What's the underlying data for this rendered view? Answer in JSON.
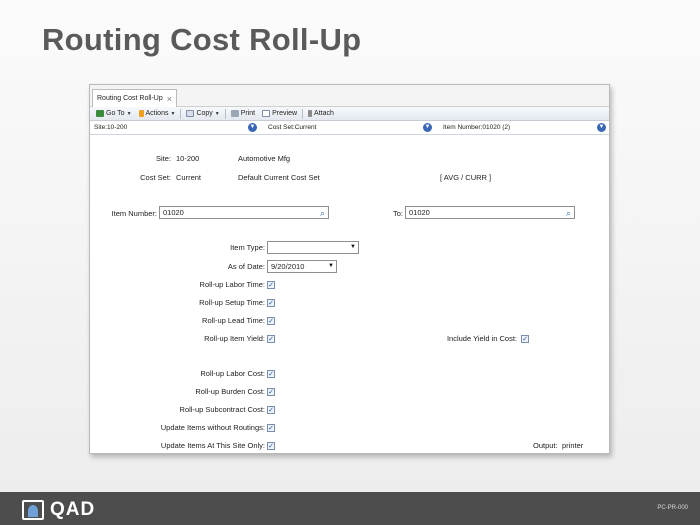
{
  "slide": {
    "title": "Routing Cost Roll-Up",
    "footer_code": "PC-PR-000",
    "brand": "QAD"
  },
  "tab": {
    "label": "Routing Cost Roll-Up",
    "close": "×"
  },
  "toolbar": {
    "goto": "Go To",
    "actions": "Actions",
    "copy": "Copy",
    "print": "Print",
    "preview": "Preview",
    "attach": "Attach"
  },
  "filters": {
    "site": "Site:10-200",
    "cost_set": "Cost Set:Current",
    "item_number": "Item Number:01020 (2)"
  },
  "form": {
    "site_label": "Site:",
    "site_value": "10-200",
    "site_desc": "Automotive Mfg",
    "cost_set_label": "Cost Set:",
    "cost_set_value": "Current",
    "cost_set_desc": "Default Current Cost Set",
    "cost_method": "[ AVG / CURR ]",
    "item_number_label": "Item Number:",
    "item_number_value": "01020",
    "to_label": "To:",
    "to_value": "01020",
    "item_type_label": "Item Type:",
    "item_type_value": "",
    "as_of_date_label": "As of Date:",
    "as_of_date_value": "9/20/2010",
    "labor_time_label": "Roll-up Labor Time:",
    "setup_time_label": "Roll-up Setup Time:",
    "lead_time_label": "Roll-up Lead Time:",
    "item_yield_label": "Roll-up Item Yield:",
    "include_yield_label": "Include Yield in Cost:",
    "labor_cost_label": "Roll-up Labor Cost:",
    "burden_cost_label": "Roll-up Burden Cost:",
    "subcontract_cost_label": "Roll-up Subcontract Cost:",
    "without_routings_label": "Update Items without Routings:",
    "this_site_only_label": "Update Items At This Site Only:",
    "output_label": "Output:",
    "output_value": "printer",
    "checked_glyph": "✓"
  },
  "icons": {
    "search": "search-icon",
    "dropdown": "chevron-down-icon"
  },
  "colors": {
    "accent": "#3a67b4",
    "footer": "#4d4d4d"
  }
}
